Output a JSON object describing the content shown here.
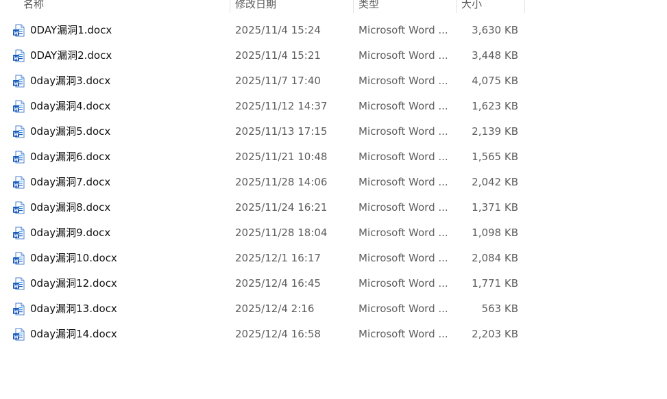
{
  "header": {
    "name": "名称",
    "date": "修改日期",
    "type": "类型",
    "size": "大小"
  },
  "icon": "word-document-icon",
  "colors": {
    "word_blue": "#185abd",
    "word_light": "#41a5ee"
  },
  "files": [
    {
      "name": "0DAY漏洞1.docx",
      "date": "2025/11/4 15:24",
      "type": "Microsoft Word ...",
      "size": "3,630 KB"
    },
    {
      "name": "0DAY漏洞2.docx",
      "date": "2025/11/4 15:21",
      "type": "Microsoft Word ...",
      "size": "3,448 KB"
    },
    {
      "name": "0day漏洞3.docx",
      "date": "2025/11/7 17:40",
      "type": "Microsoft Word ...",
      "size": "4,075 KB"
    },
    {
      "name": "0day漏洞4.docx",
      "date": "2025/11/12 14:37",
      "type": "Microsoft Word ...",
      "size": "1,623 KB"
    },
    {
      "name": "0day漏洞5.docx",
      "date": "2025/11/13 17:15",
      "type": "Microsoft Word ...",
      "size": "2,139 KB"
    },
    {
      "name": "0day漏洞6.docx",
      "date": "2025/11/21 10:48",
      "type": "Microsoft Word ...",
      "size": "1,565 KB"
    },
    {
      "name": "0day漏洞7.docx",
      "date": "2025/11/28 14:06",
      "type": "Microsoft Word ...",
      "size": "2,042 KB"
    },
    {
      "name": "0day漏洞8.docx",
      "date": "2025/11/24 16:21",
      "type": "Microsoft Word ...",
      "size": "1,371 KB"
    },
    {
      "name": "0day漏洞9.docx",
      "date": "2025/11/28 18:04",
      "type": "Microsoft Word ...",
      "size": "1,098 KB"
    },
    {
      "name": "0day漏洞10.docx",
      "date": "2025/12/1 16:17",
      "type": "Microsoft Word ...",
      "size": "2,084 KB"
    },
    {
      "name": "0day漏洞12.docx",
      "date": "2025/12/4 16:45",
      "type": "Microsoft Word ...",
      "size": "1,771 KB"
    },
    {
      "name": "0day漏洞13.docx",
      "date": "2025/12/4 2:16",
      "type": "Microsoft Word ...",
      "size": "563 KB"
    },
    {
      "name": "0day漏洞14.docx",
      "date": "2025/12/4 16:58",
      "type": "Microsoft Word ...",
      "size": "2,203 KB"
    }
  ]
}
